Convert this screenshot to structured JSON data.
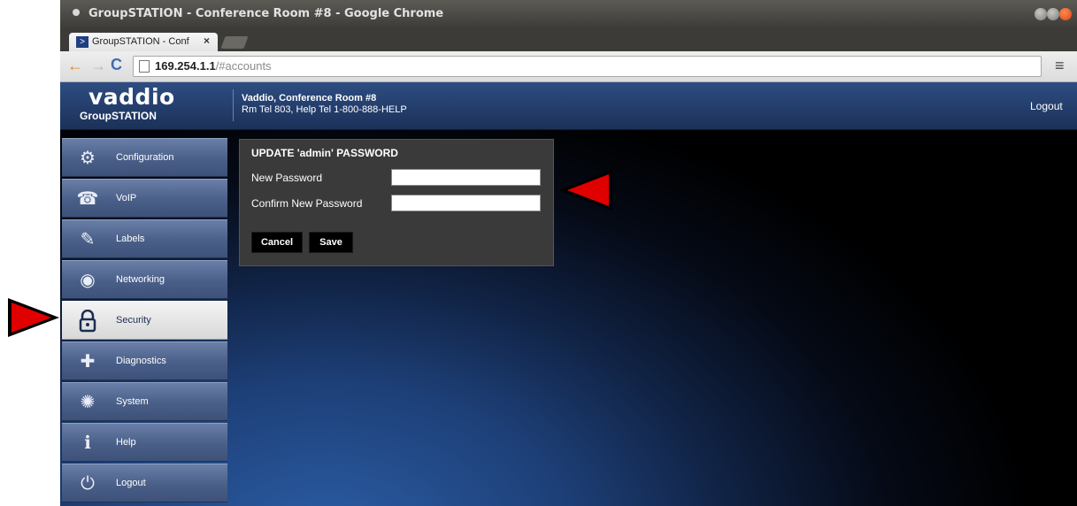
{
  "window": {
    "title": "GroupSTATION - Conference Room #8 - Google Chrome",
    "controls": [
      "minimize-icon",
      "maximize-icon",
      "close-icon"
    ]
  },
  "tab": {
    "title": "GroupSTATION - Confer",
    "close": "×",
    "favicon": "vaddio-favicon"
  },
  "toolbar": {
    "back": "←",
    "forward": "→",
    "reload": "C",
    "url_host": "169.254.1.1",
    "url_path": "/#accounts",
    "menu": "≡"
  },
  "header": {
    "brand": "vaddio",
    "product": "GroupSTATION",
    "room_name": "Vaddio, Conference Room #8",
    "room_phones": "Rm Tel 803, Help Tel 1-800-888-HELP",
    "logout": "Logout"
  },
  "sidebar": {
    "items": [
      {
        "label": "Configuration",
        "icon": "gear-icon",
        "glyph": "⚙"
      },
      {
        "label": "VoIP",
        "icon": "phone-icon",
        "glyph": "☎"
      },
      {
        "label": "Labels",
        "icon": "pencil-icon",
        "glyph": "✎"
      },
      {
        "label": "Networking",
        "icon": "network-icon",
        "glyph": "◉"
      },
      {
        "label": "Security",
        "icon": "padlock-icon",
        "glyph": "🔒",
        "active": true
      },
      {
        "label": "Diagnostics",
        "icon": "diagnostics-icon",
        "glyph": "✚"
      },
      {
        "label": "System",
        "icon": "system-gears-icon",
        "glyph": "✺"
      },
      {
        "label": "Help",
        "icon": "info-icon",
        "glyph": "ℹ"
      },
      {
        "label": "Logout",
        "icon": "power-icon",
        "glyph": "⏻"
      }
    ]
  },
  "dialog": {
    "title": "UPDATE 'admin' PASSWORD",
    "new_password_label": "New Password",
    "new_password_value": "",
    "confirm_password_label": "Confirm New Password",
    "confirm_password_value": "",
    "cancel_label": "Cancel",
    "save_label": "Save"
  },
  "colors": {
    "callout_arrow": "#e00000",
    "header_bg": "#1b3159",
    "dialog_bg": "#3a3a3a"
  }
}
